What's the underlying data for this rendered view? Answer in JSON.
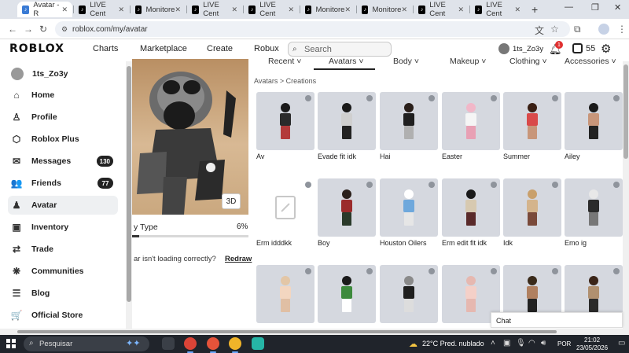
{
  "browser": {
    "tabs": [
      {
        "label": "Avatar - R",
        "active": true
      },
      {
        "label": "LIVE Cent"
      },
      {
        "label": "Monitore"
      },
      {
        "label": "LIVE Cent"
      },
      {
        "label": "LIVE Cent"
      },
      {
        "label": "Monitore"
      },
      {
        "label": "Monitore"
      },
      {
        "label": "LIVE Cent"
      },
      {
        "label": "LIVE Cent"
      }
    ],
    "tab_close": "✕",
    "new_tab": "+",
    "url": "roblox.com/my/avatar",
    "window_controls": {
      "minimize": "—",
      "maximize": "❐",
      "close": "✕"
    }
  },
  "header": {
    "logo": "ROBLOX",
    "nav": [
      "Charts",
      "Marketplace",
      "Create",
      "Robux"
    ],
    "search_placeholder": "Search",
    "username": "1ts_Zo3y",
    "notification_count": "1",
    "robux_balance": "55"
  },
  "sidebar": {
    "user": "1ts_Zo3y",
    "items": [
      {
        "label": "Home",
        "icon": "home-icon",
        "glyph": "⌂"
      },
      {
        "label": "Profile",
        "icon": "profile-icon",
        "glyph": "♙"
      },
      {
        "label": "Roblox Plus",
        "icon": "roblox-plus-icon",
        "glyph": "⬡"
      },
      {
        "label": "Messages",
        "icon": "messages-icon",
        "glyph": "✉",
        "badge": "130"
      },
      {
        "label": "Friends",
        "icon": "friends-icon",
        "glyph": "👥",
        "badge": "77"
      },
      {
        "label": "Avatar",
        "icon": "avatar-icon",
        "glyph": "♟",
        "active": true
      },
      {
        "label": "Inventory",
        "icon": "inventory-icon",
        "glyph": "▣"
      },
      {
        "label": "Trade",
        "icon": "trade-icon",
        "glyph": "⇄"
      },
      {
        "label": "Communities",
        "icon": "communities-icon",
        "glyph": "❋"
      },
      {
        "label": "Blog",
        "icon": "blog-icon",
        "glyph": "☰"
      },
      {
        "label": "Official Store",
        "icon": "store-icon",
        "glyph": "🛒"
      }
    ]
  },
  "preview": {
    "button_3d": "3D",
    "body_type_label": "y Type",
    "body_type_value": "6%",
    "body_type_level": 0.06,
    "loading_question": "ar isn't loading correctly?",
    "redraw": "Redraw"
  },
  "categories": {
    "tabs": [
      "Recent",
      "Avatars",
      "Body",
      "Makeup",
      "Clothing",
      "Accessories"
    ],
    "active": "Avatars"
  },
  "breadcrumb": "Avatars > Creations",
  "creations": [
    {
      "name": "Av",
      "hair": "#1a1a1a",
      "torso": "#2b2b2b",
      "legs": "#b33a3a"
    },
    {
      "name": "Evade fit idk",
      "hair": "#1a1a1a",
      "torso": "#cfcfcf",
      "legs": "#222222"
    },
    {
      "name": "Hai",
      "hair": "#2a1f1a",
      "torso": "#1f1f1f",
      "legs": "#b0b0b0"
    },
    {
      "name": "Easter",
      "hair": "#f1b7c8",
      "torso": "#f5f5f5",
      "legs": "#e8a0b4"
    },
    {
      "name": "Summer",
      "hair": "#3a1f14",
      "torso": "#d94a4a",
      "legs": "#c8967a"
    },
    {
      "name": "Ailey",
      "hair": "#1a1a1a",
      "torso": "#c8967a",
      "legs": "#222222"
    },
    {
      "name": "Erm idddkk",
      "empty": true
    },
    {
      "name": "Boy",
      "hair": "#2a1f1a",
      "torso": "#9b2b2b",
      "legs": "#2a3a2a"
    },
    {
      "name": "Houston Oilers",
      "hair": "#ffffff",
      "torso": "#6fa8dc",
      "legs": "#e6e6e6"
    },
    {
      "name": "Erm edit fit idk",
      "hair": "#1a1a1a",
      "torso": "#d7c9b0",
      "legs": "#5a2a2a"
    },
    {
      "name": "Idk",
      "hair": "#c9a06b",
      "torso": "#d4b48c",
      "legs": "#7a4a3a"
    },
    {
      "name": "Emo ig",
      "hair": "#e8e8e8",
      "torso": "#2b2b2b",
      "legs": "#777777"
    },
    {
      "name": "",
      "hair": "#e3c6a6",
      "torso": "#f3d6c0",
      "legs": "#e0bfa4"
    },
    {
      "name": "",
      "hair": "#1a1a1a",
      "torso": "#3d8a3d",
      "legs": "#ffffff"
    },
    {
      "name": "",
      "hair": "#8a8a8a",
      "torso": "#1f1f1f",
      "legs": "#dddddd"
    },
    {
      "name": "",
      "hair": "#e6b8b0",
      "torso": "#f4d0c8",
      "legs": "#e6b8b0"
    },
    {
      "name": "",
      "hair": "#3a2a1a",
      "torso": "#b08060",
      "legs": "#222222"
    },
    {
      "name": "",
      "hair": "#3a2418",
      "torso": "#b09070",
      "legs": "#2a2a2a"
    }
  ],
  "chat_label": "Chat",
  "taskbar": {
    "search": "Pesquisar",
    "weather": "22°C  Pred. nublado",
    "lang": "POR",
    "time": "21:02",
    "date": "23/05/2026"
  }
}
